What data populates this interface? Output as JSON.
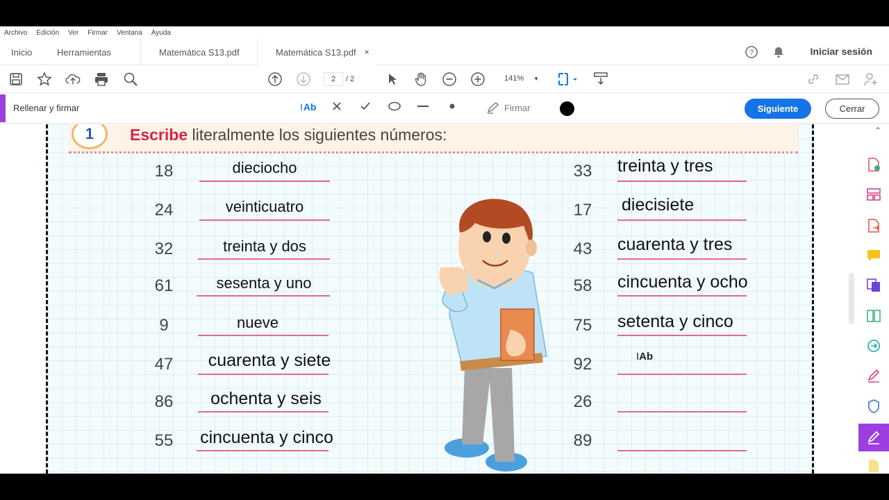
{
  "menu": [
    "Archivo",
    "Edición",
    "Ver",
    "Firmar",
    "Ventana",
    "Ayuda"
  ],
  "tabs": {
    "home": "Inicio",
    "tools": "Herramientas",
    "doc1": "Matemática S13.pdf",
    "doc2": "Matemática S13.pdf",
    "close": "×"
  },
  "signin": "Iniciar sesión",
  "pager": {
    "current": "2",
    "total": "/ 2"
  },
  "zoom": "141%",
  "fillsign": {
    "title": "Rellenar y firmar",
    "text_tool": "Ab",
    "sign": "Firmar",
    "next": "Siguiente",
    "close": "Cerrar"
  },
  "worksheet": {
    "number": "1",
    "instruction_bold": "Escribe",
    "instruction_rest": " literalmente los siguientes números:",
    "left": [
      {
        "num": "18",
        "answer": "dieciocho"
      },
      {
        "num": "24",
        "answer": "veinticuatro"
      },
      {
        "num": "32",
        "answer": "treinta y dos"
      },
      {
        "num": "61",
        "answer": "sesenta y uno"
      },
      {
        "num": "9",
        "answer": "nueve"
      },
      {
        "num": "47",
        "answer": "cuarenta y siete"
      },
      {
        "num": "86",
        "answer": "ochenta y seis"
      },
      {
        "num": "55",
        "answer": "cincuenta y cinco"
      }
    ],
    "right": [
      {
        "num": "33",
        "answer": "treinta y tres"
      },
      {
        "num": "17",
        "answer": "diecisiete"
      },
      {
        "num": "43",
        "answer": "cuarenta y tres"
      },
      {
        "num": "58",
        "answer": "cincuenta y ocho"
      },
      {
        "num": "75",
        "answer": "setenta y cinco"
      },
      {
        "num": "92",
        "answer": ""
      },
      {
        "num": "26",
        "answer": ""
      },
      {
        "num": "89",
        "answer": ""
      }
    ],
    "cursor_label": "Ab"
  },
  "colors": {
    "accent": "#9d3fe0",
    "primary": "#1473e6",
    "line": "#e06a8a",
    "red": "#d6234a"
  }
}
